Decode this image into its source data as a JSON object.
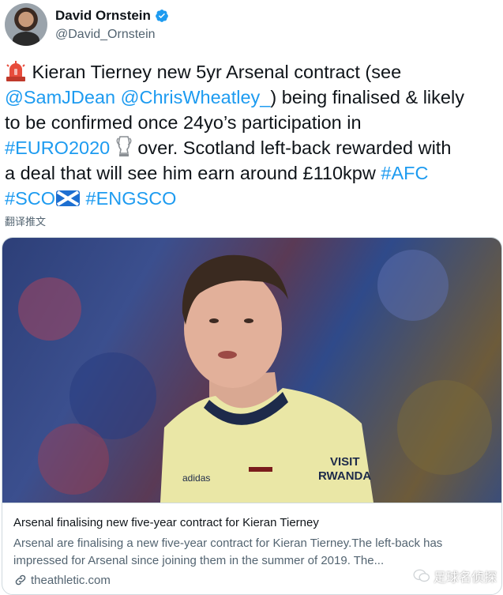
{
  "author": {
    "display_name": "David Ornstein",
    "handle": "@David_Ornstein",
    "verified_color": "#1d9bf0",
    "avatar_icon": "profile-avatar"
  },
  "tweet": {
    "line1_text": "Kieran Tierney new 5yr Arsenal contract (see",
    "mention1": "@SamJDean",
    "mention2": "@ChrisWheatley_",
    "line2_text": ") being finalised & likely",
    "line3_text": "to be confirmed once 24yo’s participation in",
    "hashtag_euro": "#EURO2020",
    "line4_text": "over. Scotland left-back rewarded with",
    "line5_text": "a deal that will see him earn around £110kpw",
    "hashtag_afc": "#AFC",
    "hashtag_sco": "#SCO",
    "hashtag_engsco": "#ENGSCO",
    "siren_icon": "rotating-light-icon",
    "trophy_icon": "trophy-icon",
    "flag_icon": "scotland-flag-icon"
  },
  "translate_label": "翻译推文",
  "card": {
    "title": "Arsenal finalising new five-year contract for Kieran Tierney",
    "desc_line1": "Arsenal are finalising a new five-year contract for Kieran Tierney.The left-back has",
    "desc_line2": "impressed for Arsenal since joining them in the summer of 2019. The...",
    "domain": "theathletic.com",
    "image_text_sponsor1": "VISIT",
    "image_text_sponsor2": "RWANDA",
    "image_text_brand": "adidas"
  },
  "watermark": {
    "label": "足球名侦探"
  },
  "colors": {
    "link": "#1d9bf0",
    "text": "#0f1419",
    "muted": "#536471",
    "border": "#cfd9de"
  }
}
